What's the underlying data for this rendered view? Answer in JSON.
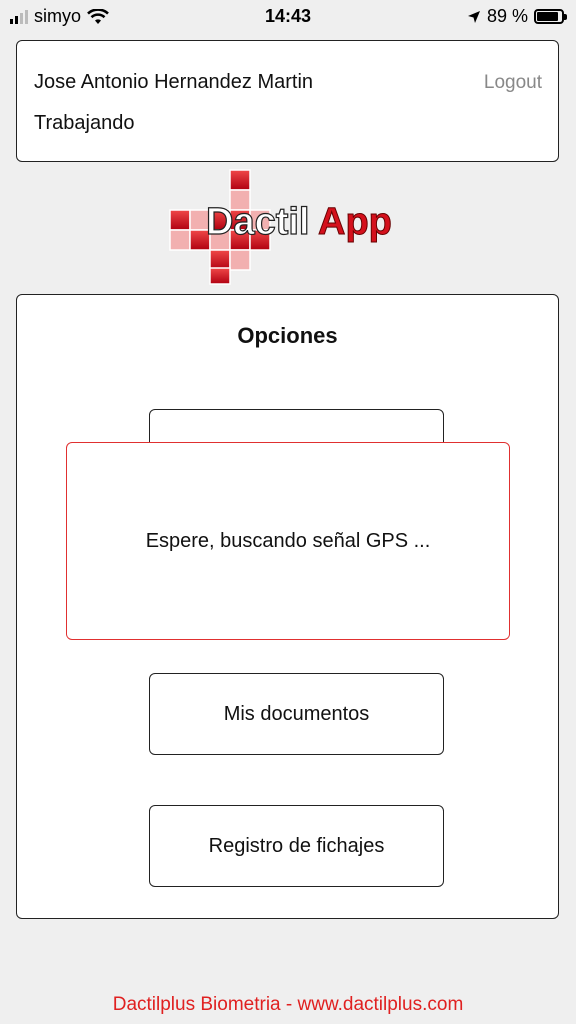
{
  "status_bar": {
    "carrier": "simyo",
    "time": "14:43",
    "battery": "89 %"
  },
  "user": {
    "name": "Jose Antonio Hernandez Martin",
    "status": "Trabajando",
    "logout_label": "Logout"
  },
  "logo": {
    "text": "DactilApp"
  },
  "options": {
    "title": "Opciones",
    "buttons": [
      {
        "label": ""
      },
      {
        "label": "Mis documentos"
      },
      {
        "label": "Registro de fichajes"
      }
    ]
  },
  "gps_overlay": {
    "message": "Espere, buscando señal GPS ..."
  },
  "footer": {
    "text": "Dactilplus Biometria - www.dactilplus.com"
  },
  "colors": {
    "accent_red": "#e02020",
    "overlay_border": "#e03030"
  }
}
